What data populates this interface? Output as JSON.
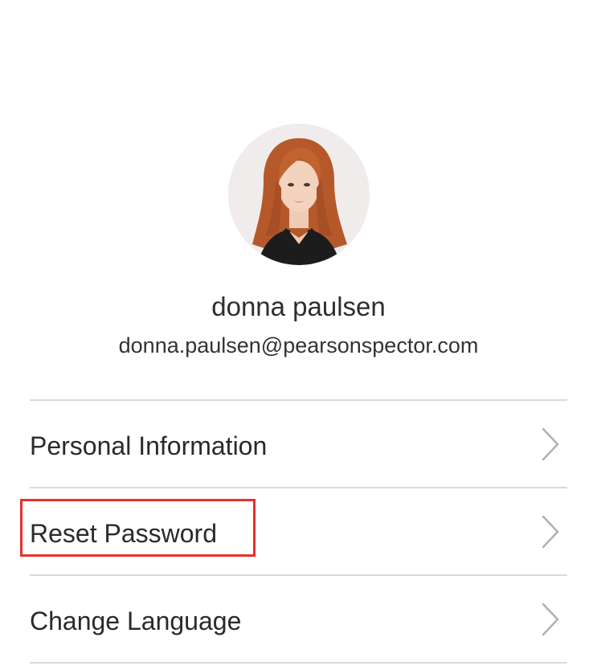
{
  "profile": {
    "name": "donna paulsen",
    "email": "donna.paulsen@pearsonspector.com",
    "avatar_icon": "user-photo"
  },
  "menu": {
    "items": [
      {
        "label": "Personal Information",
        "icon": "chevron-right-icon"
      },
      {
        "label": "Reset Password",
        "icon": "chevron-right-icon",
        "highlighted": true
      },
      {
        "label": "Change Language",
        "icon": "chevron-right-icon"
      }
    ]
  },
  "colors": {
    "divider": "#d9d9d9",
    "highlight": "#e8302a",
    "chevron": "#b0b0b0"
  }
}
